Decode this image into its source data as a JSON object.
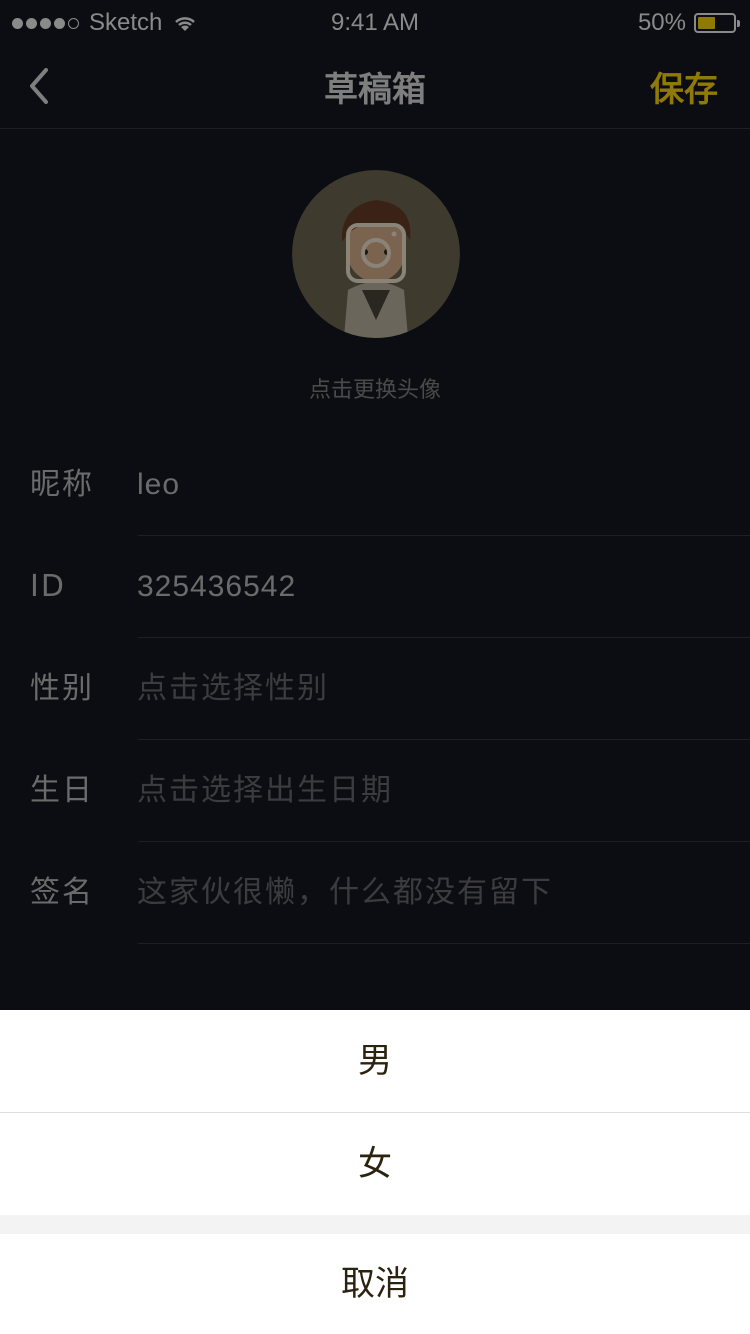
{
  "status_bar": {
    "carrier": "Sketch",
    "time": "9:41 AM",
    "battery_percent": "50%",
    "battery_level": 0.5,
    "wifi_icon": "wifi-icon",
    "signal_icon": "signal-dots-icon"
  },
  "nav": {
    "back_icon": "chevron-left-icon",
    "title": "草稿箱",
    "save_label": "保存"
  },
  "avatar": {
    "camera_icon": "camera-icon",
    "hint": "点击更换头像"
  },
  "form": {
    "nickname": {
      "label": "昵称",
      "value": "leo"
    },
    "id": {
      "label": "ID",
      "value": "325436542"
    },
    "gender": {
      "label": "性别",
      "placeholder": "点击选择性别"
    },
    "birthday": {
      "label": "生日",
      "placeholder": "点击选择出生日期"
    },
    "signature": {
      "label": "签名",
      "placeholder": "这家伙很懒，什么都没有留下"
    }
  },
  "action_sheet": {
    "options": [
      "男",
      "女"
    ],
    "cancel_label": "取消"
  },
  "colors": {
    "background": "#0c0d12",
    "accent": "#8f7a07",
    "sheet_bg": "#ffffff"
  }
}
